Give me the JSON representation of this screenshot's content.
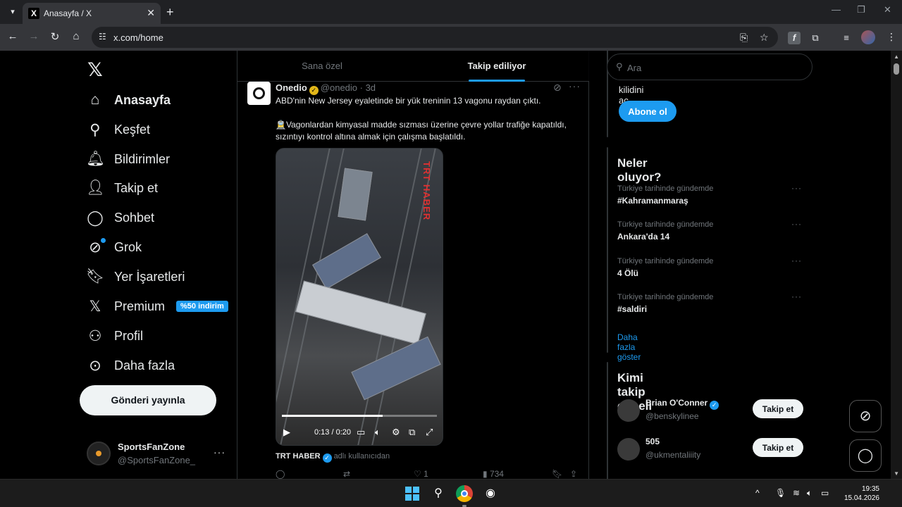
{
  "browser": {
    "tab_title": "Anasayfa / X",
    "url": "x.com/home"
  },
  "nav": {
    "items": [
      {
        "label": "Anasayfa",
        "icon": "home-icon",
        "bold": true
      },
      {
        "label": "Keşfet",
        "icon": "search-icon"
      },
      {
        "label": "Bildirimler",
        "icon": "bell-icon"
      },
      {
        "label": "Takip et",
        "icon": "add-person-icon"
      },
      {
        "label": "Sohbet",
        "icon": "chat-bubble-icon"
      },
      {
        "label": "Grok",
        "icon": "grok-icon"
      },
      {
        "label": "Yer İşaretleri",
        "icon": "bookmark-icon"
      },
      {
        "label": "Premium",
        "icon": "x-logo-icon",
        "badge": "%50 indirim"
      },
      {
        "label": "Profil",
        "icon": "person-icon"
      },
      {
        "label": "Daha fazla",
        "icon": "more-circle-icon"
      }
    ],
    "post_button": "Gönderi yayınla",
    "account": {
      "name": "SportsFanZone",
      "handle": "@SportsFanZone_"
    }
  },
  "feed": {
    "tabs": [
      "Sana özel",
      "Takip ediliyor"
    ],
    "tweet": {
      "name": "Onedio",
      "handle": "@onedio",
      "time": "3d",
      "meta": "@onedio · 3d",
      "line1": "ABD'nin New Jersey eyaletinde bir yük treninin 13 vagonu raydan çıktı.",
      "line2": "🚊Vagonlardan kimyasal madde sızması üzerine çevre yollar trafiğe kapatıldı, sızıntıyı kontrol altına almak için çalışma başlatıldı.",
      "video": {
        "watermark_a": "TRT",
        "watermark_b": "HABER",
        "time": "0:13 / 0:20",
        "progress": 0.65
      },
      "source_name": "TRT HABER",
      "source_suffix": "adlı kullanıcıdan",
      "likes": "1",
      "views": "734"
    }
  },
  "right": {
    "search_placeholder": "Ara",
    "premium_text": "kilidini aç.",
    "subscribe_label": "Abone ol",
    "trends_title": "Neler oluyor?",
    "trends": [
      {
        "context": "Türkiye tarihinde gündemde",
        "name": "#Kahramanmaraş"
      },
      {
        "context": "Türkiye tarihinde gündemde",
        "name": "Ankara'da 14"
      },
      {
        "context": "Türkiye tarihinde gündemde",
        "name": "4 Ölü"
      },
      {
        "context": "Türkiye tarihinde gündemde",
        "name": "#saldiri"
      }
    ],
    "show_more": "Daha fazla göster",
    "follow_title": "Kimi takip etmeli",
    "follow": [
      {
        "name": "Brian O'Conner",
        "handle": "@benskylinee",
        "button": "Takip et",
        "verified": true
      },
      {
        "name": "505",
        "handle": "@ukmentaliiity",
        "button": "Takip et",
        "verified": false
      }
    ]
  },
  "taskbar": {
    "time": "19:35",
    "date": "15.04.2026"
  }
}
